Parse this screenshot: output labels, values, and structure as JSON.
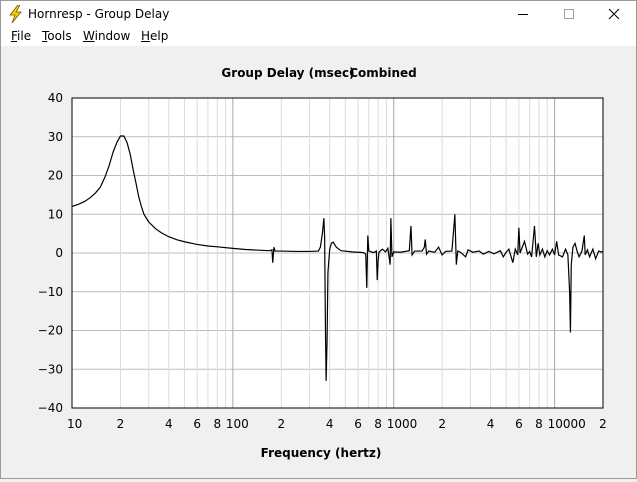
{
  "window": {
    "title": "Hornresp - Group Delay",
    "icon": "lightning-bolt-icon",
    "controls": [
      "minimize-icon",
      "maximize-icon",
      "close-icon"
    ]
  },
  "menu": [
    {
      "label": "File",
      "accel": "F",
      "rest": "ile"
    },
    {
      "label": "Tools",
      "accel": "T",
      "rest": "ools"
    },
    {
      "label": "Window",
      "accel": "W",
      "rest": "indow"
    },
    {
      "label": "Help",
      "accel": "H",
      "rest": "elp"
    }
  ],
  "chart_data": {
    "type": "line",
    "title": "Group Delay (msec)",
    "subtitle": "Combined",
    "xlabel": "Frequency (hertz)",
    "ylabel": "",
    "x_scale": "log",
    "xlim": [
      10,
      20000
    ],
    "ylim": [
      -40,
      40
    ],
    "y_ticks": [
      40,
      30,
      20,
      10,
      0,
      -10,
      -20,
      -30,
      -40
    ],
    "y_tick_labels": [
      "40",
      "30",
      "20",
      "10",
      "0",
      "−10",
      "−20",
      "−30",
      "−40"
    ],
    "x_tick_labels": [
      {
        "x": 10,
        "label": "10"
      },
      {
        "x": 20,
        "label": "2"
      },
      {
        "x": 40,
        "label": "4"
      },
      {
        "x": 60,
        "label": "6"
      },
      {
        "x": 80,
        "label": "8"
      },
      {
        "x": 100,
        "label": "100"
      },
      {
        "x": 200,
        "label": "2"
      },
      {
        "x": 400,
        "label": "4"
      },
      {
        "x": 600,
        "label": "6"
      },
      {
        "x": 800,
        "label": "8"
      },
      {
        "x": 1000,
        "label": "1000"
      },
      {
        "x": 2000,
        "label": "2"
      },
      {
        "x": 4000,
        "label": "4"
      },
      {
        "x": 6000,
        "label": "6"
      },
      {
        "x": 8000,
        "label": "8"
      },
      {
        "x": 10000,
        "label": "10000"
      },
      {
        "x": 20000,
        "label": "2"
      }
    ],
    "grid": true,
    "line_color": "#000000",
    "series": [
      {
        "points": [
          [
            10,
            12.0
          ],
          [
            11,
            12.6
          ],
          [
            12,
            13.3
          ],
          [
            13,
            14.3
          ],
          [
            14,
            15.5
          ],
          [
            15,
            17.0
          ],
          [
            16,
            19.5
          ],
          [
            17,
            22.5
          ],
          [
            18,
            26.0
          ],
          [
            19,
            28.5
          ],
          [
            20,
            30.2
          ],
          [
            21,
            30.2
          ],
          [
            22,
            28.5
          ],
          [
            23,
            25.5
          ],
          [
            24,
            21.5
          ],
          [
            25,
            18.0
          ],
          [
            26,
            14.5
          ],
          [
            27,
            12.0
          ],
          [
            28,
            10.0
          ],
          [
            30,
            8.0
          ],
          [
            33,
            6.3
          ],
          [
            36,
            5.2
          ],
          [
            40,
            4.2
          ],
          [
            45,
            3.4
          ],
          [
            50,
            2.9
          ],
          [
            60,
            2.2
          ],
          [
            70,
            1.8
          ],
          [
            80,
            1.6
          ],
          [
            100,
            1.2
          ],
          [
            120,
            0.9
          ],
          [
            150,
            0.7
          ],
          [
            170,
            0.6
          ],
          [
            175,
            0.8
          ],
          [
            177,
            -2.5
          ],
          [
            180,
            1.5
          ],
          [
            183,
            0.5
          ],
          [
            200,
            0.5
          ],
          [
            250,
            0.4
          ],
          [
            300,
            0.4
          ],
          [
            340,
            0.5
          ],
          [
            350,
            1.5
          ],
          [
            360,
            5.0
          ],
          [
            368,
            9.0
          ],
          [
            372,
            4.0
          ],
          [
            376,
            -18.0
          ],
          [
            380,
            -33.0
          ],
          [
            385,
            -23.0
          ],
          [
            390,
            -5.0
          ],
          [
            400,
            1.0
          ],
          [
            410,
            2.5
          ],
          [
            420,
            2.8
          ],
          [
            440,
            1.5
          ],
          [
            470,
            0.6
          ],
          [
            550,
            0.3
          ],
          [
            600,
            0.2
          ],
          [
            650,
            0.1
          ],
          [
            670,
            -0.3
          ],
          [
            680,
            -9.0
          ],
          [
            690,
            4.5
          ],
          [
            700,
            0.5
          ],
          [
            750,
            0.1
          ],
          [
            780,
            0.5
          ],
          [
            790,
            -7.0
          ],
          [
            800,
            -2.0
          ],
          [
            810,
            0.2
          ],
          [
            850,
            1.0
          ],
          [
            890,
            0.3
          ],
          [
            920,
            1.2
          ],
          [
            950,
            -3.0
          ],
          [
            960,
            9.0
          ],
          [
            975,
            -1.0
          ],
          [
            1000,
            0.3
          ],
          [
            1100,
            0.2
          ],
          [
            1250,
            0.6
          ],
          [
            1280,
            7.0
          ],
          [
            1300,
            -0.5
          ],
          [
            1350,
            0.5
          ],
          [
            1500,
            0.5
          ],
          [
            1550,
            1.5
          ],
          [
            1570,
            3.5
          ],
          [
            1600,
            -0.3
          ],
          [
            1650,
            0.5
          ],
          [
            1800,
            0.2
          ],
          [
            1900,
            1.5
          ],
          [
            2000,
            -0.5
          ],
          [
            2100,
            0.4
          ],
          [
            2300,
            0.5
          ],
          [
            2400,
            10.0
          ],
          [
            2450,
            -3.0
          ],
          [
            2500,
            0.5
          ],
          [
            2600,
            0.2
          ],
          [
            2800,
            -1.0
          ],
          [
            2900,
            0.8
          ],
          [
            3100,
            0.2
          ],
          [
            3400,
            0.5
          ],
          [
            3600,
            -0.3
          ],
          [
            3900,
            0.4
          ],
          [
            4200,
            -0.2
          ],
          [
            4600,
            0.6
          ],
          [
            4800,
            -1.0
          ],
          [
            5000,
            0.2
          ],
          [
            5200,
            1.0
          ],
          [
            5500,
            -2.5
          ],
          [
            5700,
            1.0
          ],
          [
            5900,
            -0.5
          ],
          [
            6000,
            6.5
          ],
          [
            6100,
            0.0
          ],
          [
            6500,
            3.0
          ],
          [
            6800,
            -0.3
          ],
          [
            7000,
            0.4
          ],
          [
            7200,
            -1.0
          ],
          [
            7500,
            7.0
          ],
          [
            7700,
            -1.0
          ],
          [
            7900,
            2.5
          ],
          [
            8100,
            -0.5
          ],
          [
            8400,
            1.0
          ],
          [
            8700,
            -1.0
          ],
          [
            9000,
            0.6
          ],
          [
            9300,
            -0.5
          ],
          [
            9700,
            1.0
          ],
          [
            10000,
            -0.5
          ],
          [
            10300,
            3.0
          ],
          [
            10600,
            -0.5
          ],
          [
            11200,
            -1.0
          ],
          [
            11700,
            1.0
          ],
          [
            12100,
            -0.5
          ],
          [
            12400,
            -10.0
          ],
          [
            12550,
            -20.5
          ],
          [
            12700,
            -3.0
          ],
          [
            13000,
            1.5
          ],
          [
            13400,
            2.5
          ],
          [
            13800,
            0.5
          ],
          [
            14200,
            -1.0
          ],
          [
            14800,
            0.5
          ],
          [
            15300,
            4.5
          ],
          [
            15500,
            -0.5
          ],
          [
            16000,
            0.8
          ],
          [
            16500,
            -1.0
          ],
          [
            17300,
            1.0
          ],
          [
            18000,
            -1.5
          ],
          [
            18800,
            0.5
          ],
          [
            19400,
            0.3
          ],
          [
            20000,
            0.3
          ]
        ]
      }
    ]
  }
}
